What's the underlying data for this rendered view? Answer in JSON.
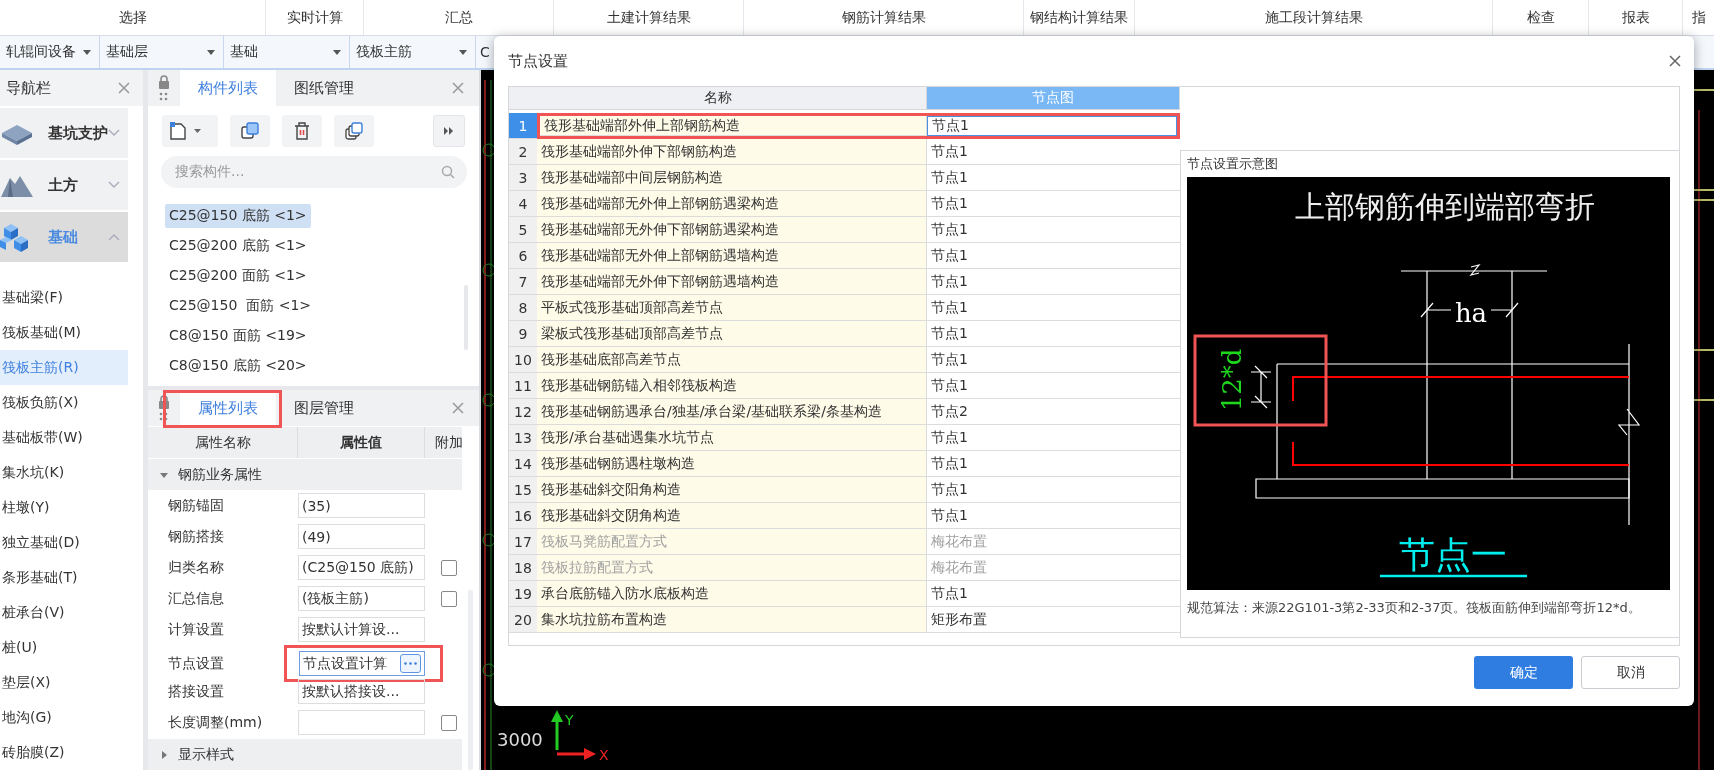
{
  "ribbon_tabs": [
    {
      "label": "选择"
    },
    {
      "label": "实时计算"
    },
    {
      "label": "汇总"
    },
    {
      "label": "土建计算结果"
    },
    {
      "label": "钢筋计算结果"
    },
    {
      "label": "钢结构计算结果"
    },
    {
      "label": "施工段计算结果"
    },
    {
      "label": "检查"
    },
    {
      "label": "报表"
    },
    {
      "label": "指"
    }
  ],
  "context_bar": [
    {
      "label": "轧辊间设备"
    },
    {
      "label": "基础层"
    },
    {
      "label": "基础"
    },
    {
      "label": "筏板主筋"
    },
    {
      "label": "C"
    }
  ],
  "nav": {
    "title": "导航栏",
    "groups": [
      {
        "label": "基坑支护",
        "expanded": false,
        "selected": false
      },
      {
        "label": "土方",
        "expanded": false,
        "selected": false
      },
      {
        "label": "基础",
        "expanded": true,
        "selected": true,
        "children": [
          {
            "label": "基础梁(F)",
            "selected": false
          },
          {
            "label": "筏板基础(M)",
            "selected": false
          },
          {
            "label": "筏板主筋(R)",
            "selected": true
          },
          {
            "label": "筏板负筋(X)",
            "selected": false
          },
          {
            "label": "基础板带(W)",
            "selected": false
          },
          {
            "label": "集水坑(K)",
            "selected": false
          },
          {
            "label": "柱墩(Y)",
            "selected": false
          },
          {
            "label": "独立基础(D)",
            "selected": false
          },
          {
            "label": "条形基础(T)",
            "selected": false
          },
          {
            "label": "桩承台(V)",
            "selected": false
          },
          {
            "label": "桩(U)",
            "selected": false
          },
          {
            "label": "垫层(X)",
            "selected": false
          },
          {
            "label": "地沟(G)",
            "selected": false
          },
          {
            "label": "砖胎膜(Z)",
            "selected": false
          }
        ]
      }
    ]
  },
  "component_panel": {
    "tabs": [
      {
        "label": "构件列表",
        "selected": true
      },
      {
        "label": "图纸管理",
        "selected": false
      }
    ],
    "search": {
      "placeholder": "搜索构件..."
    },
    "items": [
      {
        "label": "C25@150 底筋 <1>",
        "selected": true
      },
      {
        "label": "C25@200 底筋 <1>",
        "selected": false
      },
      {
        "label": "C25@200 面筋 <1>",
        "selected": false
      },
      {
        "label": "C25@150  面筋 <1>",
        "selected": false
      },
      {
        "label": "C8@150 面筋 <19>",
        "selected": false
      },
      {
        "label": "C8@150 底筋 <20>",
        "selected": false
      }
    ]
  },
  "property_panel": {
    "tabs": [
      {
        "label": "属性列表",
        "selected": true,
        "highlighted": true
      },
      {
        "label": "图层管理",
        "selected": false,
        "highlighted": false
      }
    ],
    "columns": [
      "属性名称",
      "属性值",
      "附加"
    ],
    "groups": [
      {
        "label": "钢筋业务属性",
        "expanded": true,
        "rows": [
          {
            "name": "钢筋锚固",
            "value": "(35)",
            "kind": "text"
          },
          {
            "name": "钢筋搭接",
            "value": "(49)",
            "kind": "text"
          },
          {
            "name": "归类名称",
            "value": "(C25@150 底筋)",
            "kind": "text",
            "checked": false
          },
          {
            "name": "汇总信息",
            "value": "(筏板主筋)",
            "kind": "text",
            "checked": false
          },
          {
            "name": "计算设置",
            "value": "按默认计算设...",
            "kind": "text"
          },
          {
            "name": "节点设置",
            "value": "节点设置计算",
            "kind": "picker",
            "highlighted": true
          },
          {
            "name": "搭接设置",
            "value": "按默认搭接设...",
            "kind": "text"
          },
          {
            "name": "长度调整(mm)",
            "kind": "text",
            "checked": false
          }
        ]
      },
      {
        "label": "显示样式",
        "expanded": false
      }
    ]
  },
  "canvas": {
    "axis_labels": [
      "Y",
      "X"
    ],
    "dimension": "3000"
  },
  "dialog": {
    "title": "节点设置",
    "columns": [
      {
        "label": "名称",
        "selected": false
      },
      {
        "label": "节点图",
        "selected": true
      }
    ],
    "rows": [
      {
        "index": "1",
        "name": "筏形基础端部外伸上部钢筋构造",
        "value": "节点1",
        "selected": true,
        "disabled": false,
        "highlighted": true
      },
      {
        "index": "2",
        "name": "筏形基础端部外伸下部钢筋构造",
        "value": "节点1",
        "selected": false,
        "disabled": false
      },
      {
        "index": "3",
        "name": "筏形基础端部中间层钢筋构造",
        "value": "节点1",
        "selected": false,
        "disabled": false
      },
      {
        "index": "4",
        "name": "筏形基础端部无外伸上部钢筋遇梁构造",
        "value": "节点1",
        "selected": false,
        "disabled": false
      },
      {
        "index": "5",
        "name": "筏形基础端部无外伸下部钢筋遇梁构造",
        "value": "节点1",
        "selected": false,
        "disabled": false
      },
      {
        "index": "6",
        "name": "筏形基础端部无外伸上部钢筋遇墙构造",
        "value": "节点1",
        "selected": false,
        "disabled": false
      },
      {
        "index": "7",
        "name": "筏形基础端部无外伸下部钢筋遇墙构造",
        "value": "节点1",
        "selected": false,
        "disabled": false
      },
      {
        "index": "8",
        "name": "平板式筏形基础顶部高差节点",
        "value": "节点1",
        "selected": false,
        "disabled": false
      },
      {
        "index": "9",
        "name": "梁板式筏形基础顶部高差节点",
        "value": "节点1",
        "selected": false,
        "disabled": false
      },
      {
        "index": "10",
        "name": "筏形基础底部高差节点",
        "value": "节点1",
        "selected": false,
        "disabled": false
      },
      {
        "index": "11",
        "name": "筏形基础钢筋锚入相邻筏板构造",
        "value": "节点1",
        "selected": false,
        "disabled": false
      },
      {
        "index": "12",
        "name": "筏形基础钢筋遇承台/独基/承台梁/基础联系梁/条基构造",
        "value": "节点2",
        "selected": false,
        "disabled": false
      },
      {
        "index": "13",
        "name": "筏形/承台基础遇集水坑节点",
        "value": "节点1",
        "selected": false,
        "disabled": false
      },
      {
        "index": "14",
        "name": "筏形基础钢筋遇柱墩构造",
        "value": "节点1",
        "selected": false,
        "disabled": false
      },
      {
        "index": "15",
        "name": "筏形基础斜交阳角构造",
        "value": "节点1",
        "selected": false,
        "disabled": false
      },
      {
        "index": "16",
        "name": "筏形基础斜交阴角构造",
        "value": "节点1",
        "selected": false,
        "disabled": false
      },
      {
        "index": "17",
        "name": "筏板马凳筋配置方式",
        "value": "梅花布置",
        "selected": false,
        "disabled": true
      },
      {
        "index": "18",
        "name": "筏板拉筋配置方式",
        "value": "梅花布置",
        "selected": false,
        "disabled": true
      },
      {
        "index": "19",
        "name": "承台底筋锚入防水底板构造",
        "value": "节点1",
        "selected": false,
        "disabled": false
      },
      {
        "index": "20",
        "name": "集水坑拉筋布置构造",
        "value": "矩形布置",
        "selected": false,
        "disabled": false
      }
    ],
    "preview": {
      "title": "节点设置示意图",
      "diagram": {
        "heading": "上部钢筋伸到端部弯折",
        "dimension": "ha",
        "bend_label": "12*d",
        "caption": "节点一",
        "highlighted": true
      },
      "note": "规范算法：来源22G101-3第2-33页和2-37页。筏板面筋伸到端部弯折12*d。"
    },
    "buttons": [
      {
        "label": "确定",
        "kind": "primary"
      },
      {
        "label": "取消",
        "kind": "secondary"
      }
    ]
  }
}
